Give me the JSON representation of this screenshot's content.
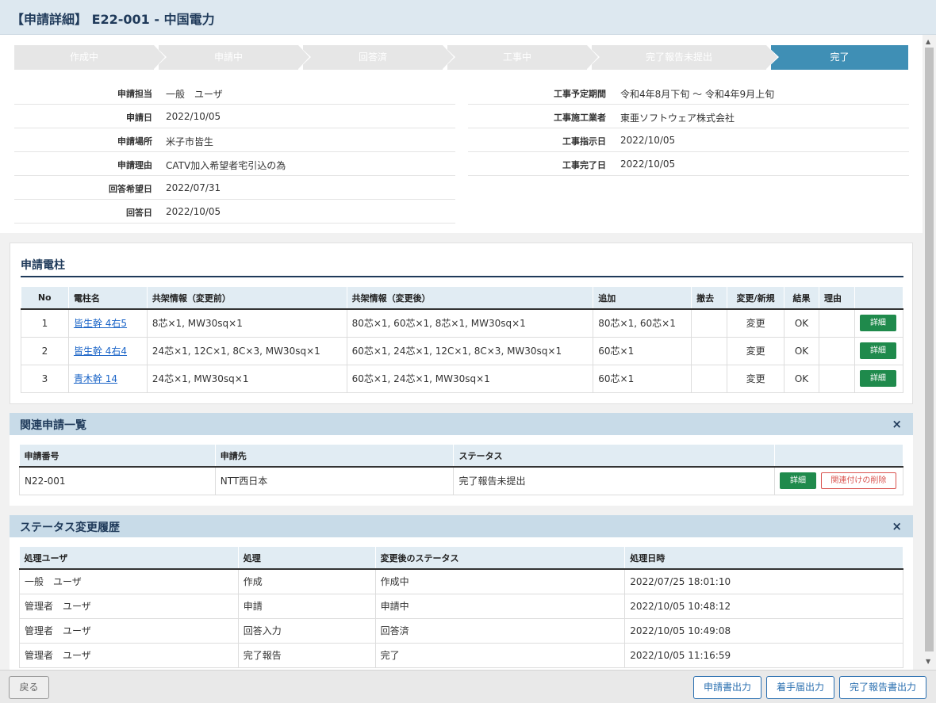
{
  "header": {
    "title": "【申請詳細】 E22-001 - 中国電力"
  },
  "steps": [
    "作成中",
    "申請中",
    "回答済",
    "工事中",
    "完了報告未提出",
    "完了"
  ],
  "info_left": [
    {
      "label": "申請担当",
      "value": "一般　ユーザ"
    },
    {
      "label": "申請日",
      "value": "2022/10/05"
    },
    {
      "label": "申請場所",
      "value": "米子市皆生"
    },
    {
      "label": "申請理由",
      "value": "CATV加入希望者宅引込の為"
    },
    {
      "label": "回答希望日",
      "value": "2022/07/31"
    },
    {
      "label": "回答日",
      "value": "2022/10/05"
    }
  ],
  "info_right": [
    {
      "label": "工事予定期間",
      "value": "令和4年8月下旬 ～ 令和4年9月上旬"
    },
    {
      "label": "工事施工業者",
      "value": "東亜ソフトウェア株式会社"
    },
    {
      "label": "工事指示日",
      "value": "2022/10/05"
    },
    {
      "label": "工事完了日",
      "value": "2022/10/05"
    }
  ],
  "poles": {
    "title": "申請電柱",
    "headers": [
      "No",
      "電柱名",
      "共架情報（変更前）",
      "共架情報（変更後）",
      "追加",
      "撤去",
      "変更/新規",
      "結果",
      "理由",
      ""
    ],
    "rows": [
      {
        "no": "1",
        "name": "皆生幹 4右5",
        "before": "8芯×1, MW30sq×1",
        "after": "80芯×1, 60芯×1, 8芯×1, MW30sq×1",
        "add": "80芯×1, 60芯×1",
        "remove": "",
        "type": "変更",
        "result": "OK",
        "reason": "",
        "btn": "詳細"
      },
      {
        "no": "2",
        "name": "皆生幹 4右4",
        "before": "24芯×1, 12C×1, 8C×3, MW30sq×1",
        "after": "60芯×1, 24芯×1, 12C×1, 8C×3, MW30sq×1",
        "add": "60芯×1",
        "remove": "",
        "type": "変更",
        "result": "OK",
        "reason": "",
        "btn": "詳細"
      },
      {
        "no": "3",
        "name": "青木幹 14",
        "before": "24芯×1, MW30sq×1",
        "after": "60芯×1, 24芯×1, MW30sq×1",
        "add": "60芯×1",
        "remove": "",
        "type": "変更",
        "result": "OK",
        "reason": "",
        "btn": "詳細"
      }
    ]
  },
  "related": {
    "title": "関連申請一覧",
    "close": "×",
    "headers": [
      "申請番号",
      "申請先",
      "ステータス",
      ""
    ],
    "rows": [
      {
        "no": "N22-001",
        "dest": "NTT西日本",
        "status": "完了報告未提出",
        "detail": "詳細",
        "unlink": "関連付けの削除"
      }
    ]
  },
  "history": {
    "title": "ステータス変更履歴",
    "close": "×",
    "headers": [
      "処理ユーザ",
      "処理",
      "変更後のステータス",
      "処理日時"
    ],
    "rows": [
      {
        "user": "一般　ユーザ",
        "action": "作成",
        "status": "作成中",
        "date": "2022/07/25 18:01:10"
      },
      {
        "user": "管理者　ユーザ",
        "action": "申請",
        "status": "申請中",
        "date": "2022/10/05 10:48:12"
      },
      {
        "user": "管理者　ユーザ",
        "action": "回答入力",
        "status": "回答済",
        "date": "2022/10/05 10:49:08"
      },
      {
        "user": "管理者　ユーザ",
        "action": "完了報告",
        "status": "完了",
        "date": "2022/10/05 11:16:59"
      }
    ]
  },
  "footer": {
    "back": "戻る",
    "buttons": [
      "申請書出力",
      "着手届出力",
      "完了報告書出力"
    ]
  }
}
